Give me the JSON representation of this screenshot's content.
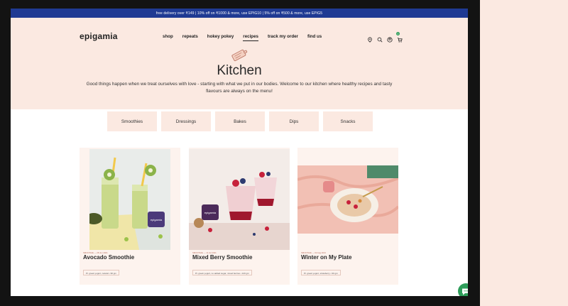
{
  "promo": "free delivery over ₹149 | 10% off on ₹1000 & more, use EPIG10 | 5% off on ₹500 & more, use EPIG5",
  "logo": "epigamia",
  "nav": [
    "shop",
    "repeats",
    "hokey pokey",
    "recipes",
    "track my order",
    "find us"
  ],
  "active_nav": "recipes",
  "header_icons": [
    "location-icon",
    "search-icon",
    "account-icon",
    "cart-icon"
  ],
  "cart_count": "0",
  "page": {
    "title": "Kitchen",
    "description": "Good things happen when we treat ourselves with love - starting with what we put in our bodies. Welcome to our kitchen where healthy recipes and tasty flavours are always on the menu!"
  },
  "tabs": [
    "Smoothies",
    "Dressings",
    "Bakes",
    "Dips",
    "Snacks"
  ],
  "cards": [
    {
      "meta": "SMOOTHIE — 28 Jun 2021",
      "title": "Avocado Smoothie",
      "ingredients": "Pl. greek yogurt, natural • 90 gm"
    },
    {
      "meta": "SMOOTHIE — 14 Jul 2021",
      "title": "Mixed Berry Smoothie",
      "ingredients": "Pl. greek yogurt, no added sugar, mixed berries • 120 gm"
    },
    {
      "meta": "SMOOTHIE — 02 Aug 2021",
      "title": "Winter on My Plate",
      "ingredients": "Pl. greek yogurt, strawberry • 90 gm"
    }
  ],
  "colors": {
    "hero_bg": "#fbe9e1",
    "promo_bg": "#1f3a93",
    "chat": "#2e9d5a"
  }
}
